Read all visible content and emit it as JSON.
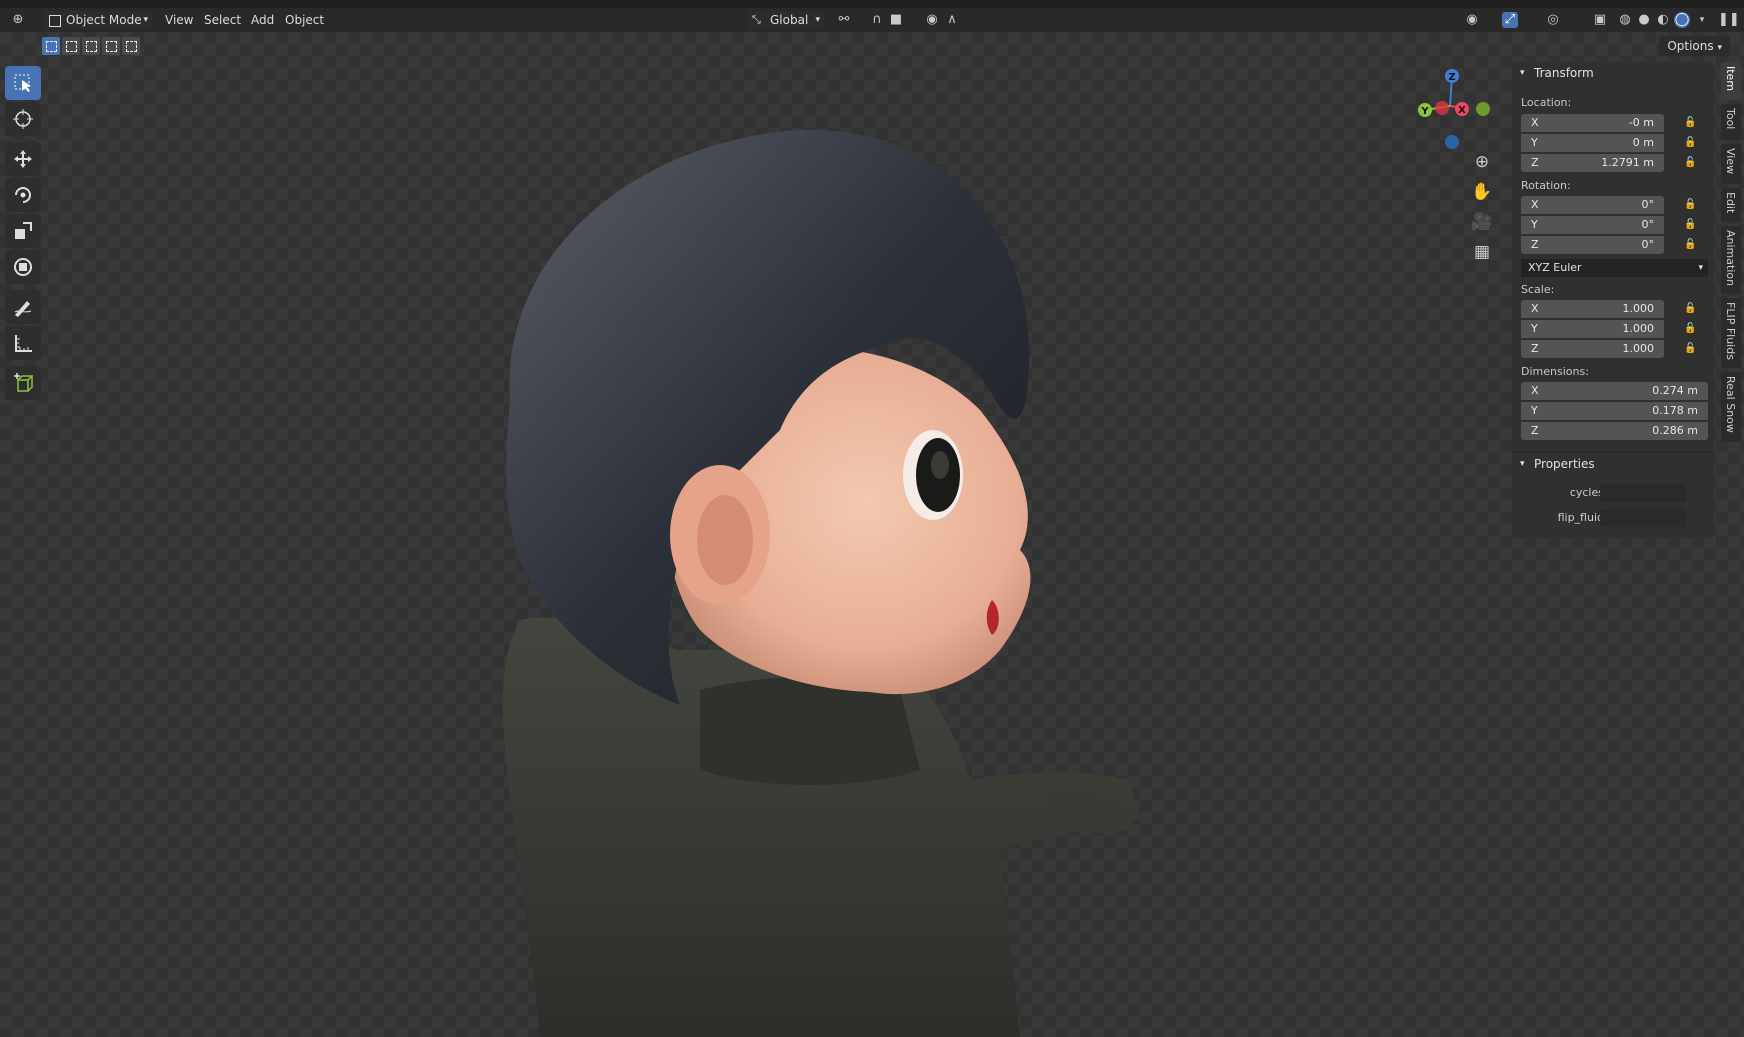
{
  "header": {
    "mode_label": "Object Mode",
    "menus": [
      "View",
      "Select",
      "Add",
      "Object"
    ],
    "orientation_label": "Global",
    "options_label": "Options"
  },
  "toolbar": {
    "tools": [
      "select-box-icon",
      "cursor-icon",
      "move-icon",
      "rotate-icon",
      "scale-icon",
      "transform-icon",
      "annotate-icon",
      "measure-icon",
      "add-cube-icon"
    ],
    "active_tool": "select-box-icon"
  },
  "gizmo": {
    "axis_labels": {
      "z": "Z",
      "y": "Y",
      "x": "X"
    },
    "colors": {
      "x": "#e8495f",
      "y": "#8cc43b",
      "z": "#3d80d6"
    }
  },
  "panel": {
    "transform": {
      "title": "Transform",
      "location_label": "Location:",
      "location": [
        {
          "axis": "X",
          "value": "-0 m"
        },
        {
          "axis": "Y",
          "value": "0 m"
        },
        {
          "axis": "Z",
          "value": "1.2791 m"
        }
      ],
      "rotation_label": "Rotation:",
      "rotation": [
        {
          "axis": "X",
          "value": "0°"
        },
        {
          "axis": "Y",
          "value": "0°"
        },
        {
          "axis": "Z",
          "value": "0°"
        }
      ],
      "rotation_mode": "XYZ Euler",
      "scale_label": "Scale:",
      "scale": [
        {
          "axis": "X",
          "value": "1.000"
        },
        {
          "axis": "Y",
          "value": "1.000"
        },
        {
          "axis": "Z",
          "value": "1.000"
        }
      ],
      "dimensions_label": "Dimensions:",
      "dimensions": [
        {
          "axis": "X",
          "value": "0.274 m"
        },
        {
          "axis": "Y",
          "value": "0.178 m"
        },
        {
          "axis": "Z",
          "value": "0.286 m"
        }
      ]
    },
    "properties": {
      "title": "Properties",
      "items": [
        {
          "label": "cycles"
        },
        {
          "label": "flip_fluid"
        }
      ]
    }
  },
  "tabs": [
    "Item",
    "Tool",
    "View",
    "Edit",
    "Animation",
    "FLIP Fluids",
    "Real Snow"
  ],
  "active_tab": "Item",
  "colors": {
    "accent": "#4772b3"
  }
}
